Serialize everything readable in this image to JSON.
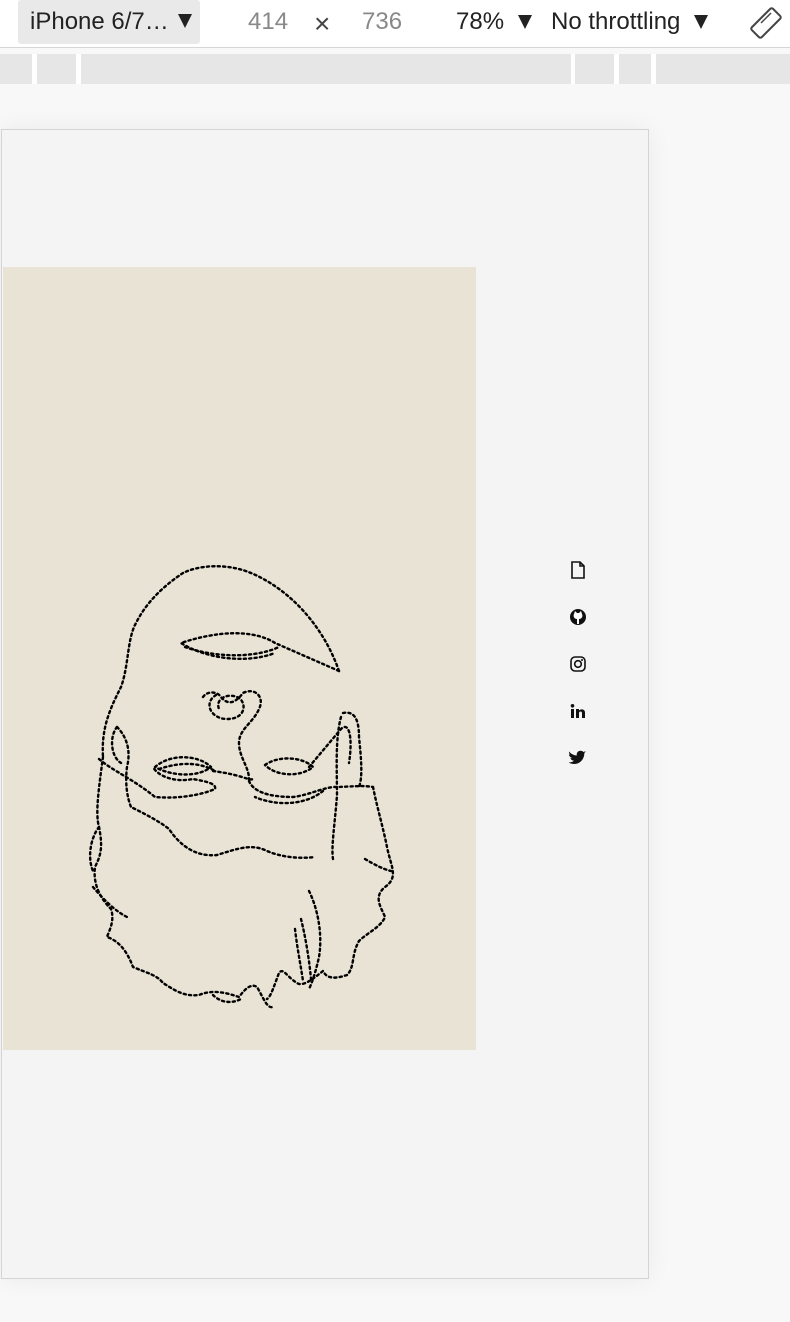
{
  "toolbar": {
    "device": "iPhone 6/7…",
    "width": "414",
    "times": "×",
    "height": "736",
    "zoom": "78%",
    "throttling": "No throttling"
  },
  "social_icons": [
    "document-icon",
    "github-icon",
    "instagram-icon",
    "linkedin-icon",
    "twitter-icon"
  ],
  "colors": {
    "art_background": "#e8e3d4",
    "viewport_background": "#f4f4f4",
    "line": "#111111"
  }
}
